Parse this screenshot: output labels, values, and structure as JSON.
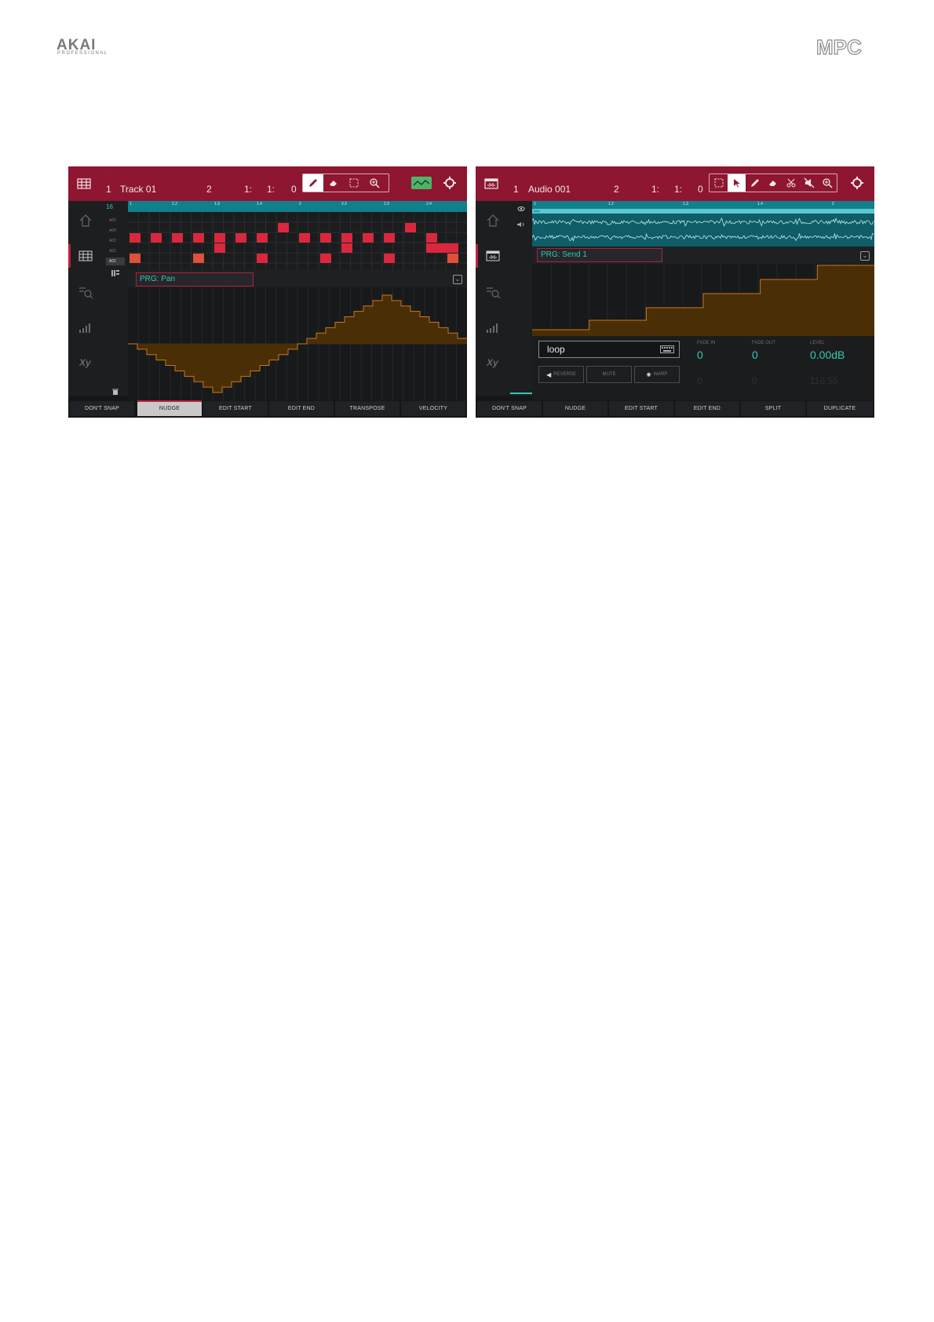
{
  "brand": {
    "akai": "AKAI",
    "akai_sub": "PROFESSIONAL",
    "mpc": "MPC"
  },
  "colors": {
    "header": "#8e1630",
    "accent_red": "#c2203e",
    "teal": "#117f8c",
    "value_text": "#34c9b4",
    "automation_fill": "#4a2e06",
    "automation_line": "#c77a1a"
  },
  "screen1": {
    "header": {
      "track_num": "1",
      "track_name": "Track 01",
      "seq": "2",
      "pos_bar": "1:",
      "pos_beat": "1:",
      "pos_tick": "0",
      "tools": [
        "pencil-icon",
        "eraser-icon",
        "marquee-icon",
        "zoom-icon"
      ],
      "active_tool": "pencil-icon"
    },
    "grid_header": "16",
    "ruler_ticks": [
      "1",
      "1.2",
      "1.3",
      "1.4",
      "2",
      "2.2",
      "2.3",
      "2.4"
    ],
    "pad_labels": [
      "A05",
      "A04",
      "A03",
      "A02",
      "A01"
    ],
    "automation_param": "PRG: Pan",
    "bottom_buttons": [
      "DON'T SNAP",
      "NUDGE",
      "EDIT START",
      "EDIT END",
      "TRANSPOSE",
      "VELOCITY"
    ],
    "active_button": "NUDGE"
  },
  "screen2": {
    "header": {
      "track_num": "1",
      "track_name": "Audio 001",
      "seq": "2",
      "pos_bar": "1:",
      "pos_beat": "1:",
      "pos_tick": "0",
      "tools": [
        "marquee-icon",
        "pointer-icon",
        "pencil-icon",
        "eraser-icon",
        "scissors-icon",
        "mute-icon",
        "zoom-icon"
      ],
      "active_tool": "pointer-icon"
    },
    "ruler_ticks": [
      "1",
      "1.2",
      "1.3",
      "1.4",
      "2"
    ],
    "clip_label": "loop",
    "automation_param": "PRG: Send 1",
    "region_name": "loop",
    "fade_in_label": "FADE IN",
    "fade_in_value": "0",
    "fade_out_label": "FADE OUT",
    "fade_out_value": "0",
    "level_label": "LEVEL",
    "level_value": "0.00dB",
    "ghost_values": [
      "0",
      "0",
      "116.55"
    ],
    "small_buttons": [
      "REVERSE",
      "MUTE",
      "WARP"
    ],
    "bottom_buttons": [
      "DON'T SNAP",
      "NUDGE",
      "EDIT START",
      "EDIT END",
      "SPLIT",
      "DUPLICATE"
    ]
  }
}
